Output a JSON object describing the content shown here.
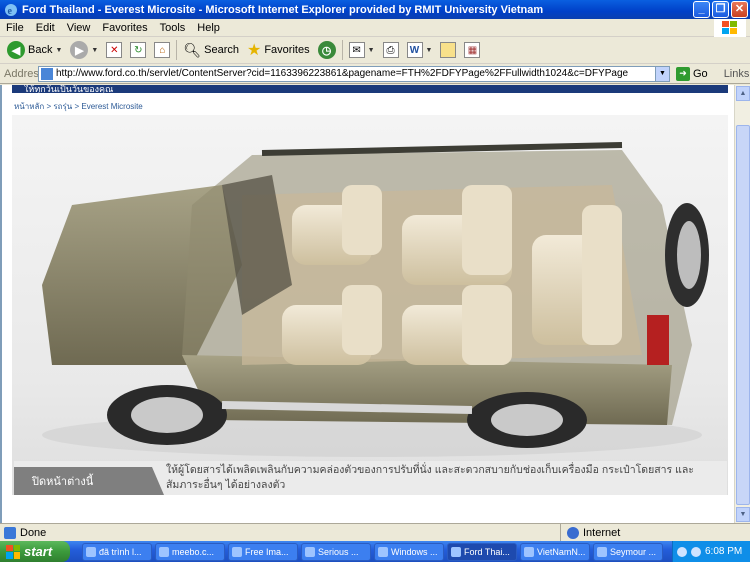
{
  "window": {
    "title": "Ford Thailand - Everest Microsite - Microsoft Internet Explorer provided by RMIT University Vietnam",
    "minimize": "_",
    "maximize": "❐",
    "close": "✕"
  },
  "menu": [
    "File",
    "Edit",
    "View",
    "Favorites",
    "Tools",
    "Help"
  ],
  "toolbar": {
    "back": "Back",
    "search": "Search",
    "favorites": "Favorites"
  },
  "address": {
    "label": "Address",
    "url": "http://www.ford.co.th/servlet/ContentServer?cid=1163396223861&pagename=FTH%2FDFYPage%2FFullwidth1024&c=DFYPage",
    "go": "Go",
    "links": "Links"
  },
  "page": {
    "topbar": "ให้ทุกวันเป็นวันของคุณ",
    "breadcrumb": "หน้าหลัก > รถรุ่น > Everest Microsite",
    "caption_tab": "ปิดหน้าต่างนี้",
    "caption_text": "ให้ผู้โดยสารได้เพลิดเพลินกับความคล่องตัวของการปรับที่นั่ง และสะดวกสบายกับช่องเก็บเครื่องมือ กระเป๋าโดยสาร และสัมภาระอื่นๆ ได้อย่างลงตัว"
  },
  "status": {
    "text": "Done",
    "zone": "Internet"
  },
  "taskbar": {
    "start": "start",
    "tasks": [
      "đã trình l...",
      "meebo.c...",
      "Free Ima...",
      "Serious ...",
      "Windows ...",
      "Ford Thai...",
      "VietNamN...",
      "Seymour ..."
    ],
    "clock": "6:08 PM"
  }
}
